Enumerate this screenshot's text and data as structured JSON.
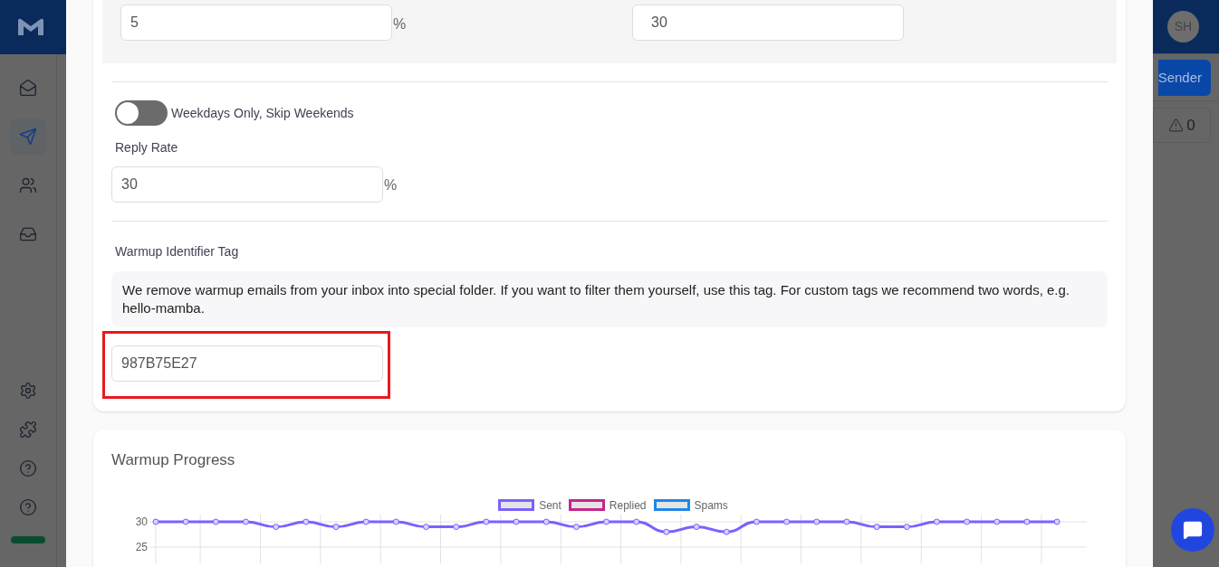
{
  "sidebar": {
    "items": [
      {
        "selected": false
      },
      {
        "selected": true
      },
      {
        "selected": false
      },
      {
        "selected": false
      }
    ],
    "bottom_items": [
      {
        "selected": false
      },
      {
        "selected": false
      },
      {
        "selected": false
      },
      {
        "selected": false
      }
    ]
  },
  "header": {
    "avatar": "SH"
  },
  "toolbar": {
    "button": "Sender",
    "warning_count": "0"
  },
  "settings": {
    "top_fields": [
      {
        "value": "5",
        "suffix": "%"
      },
      {
        "value": "30"
      }
    ],
    "weekdays_toggle": {
      "label": "Weekdays Only, Skip Weekends",
      "on": false
    },
    "reply_rate": {
      "label": "Reply Rate",
      "value": "30",
      "suffix": "%"
    },
    "identifier": {
      "label": "Warmup Identifier Tag",
      "info": "We remove warmup emails from your inbox into special folder. If you want to filter them yourself, use this tag. For custom tags we recommend two words, e.g. hello-mamba.",
      "value": "987B75E27",
      "highlighted": true
    }
  },
  "progress": {
    "title": "Warmup Progress",
    "chart_data": {
      "type": "line",
      "ylim": [
        25,
        30
      ],
      "yticks": [
        25,
        30
      ],
      "series": [
        {
          "name": "Sent",
          "color": "#7b61ff",
          "marker": true,
          "values": [
            30,
            30,
            30,
            30,
            29,
            30,
            29,
            30,
            30,
            29,
            29,
            30,
            30,
            30,
            29,
            30,
            30,
            28,
            29,
            28,
            30,
            30,
            30,
            30,
            29,
            29,
            30,
            30,
            30,
            30,
            30,
            null
          ]
        },
        {
          "name": "Replied",
          "color": "#c4268c",
          "values": [
            null,
            null,
            null,
            null,
            null,
            null,
            null,
            null,
            null,
            null,
            null,
            null,
            null,
            null,
            null,
            null,
            null,
            null,
            null,
            null,
            null,
            null,
            null,
            null,
            null,
            null,
            null,
            null,
            null,
            null,
            null,
            null
          ]
        },
        {
          "name": "Spams",
          "color": "#1e88e5",
          "values": [
            null,
            null,
            null,
            null,
            null,
            null,
            null,
            null,
            null,
            null,
            null,
            null,
            null,
            null,
            null,
            null,
            null,
            null,
            null,
            null,
            null,
            null,
            null,
            null,
            null,
            null,
            null,
            null,
            null,
            null,
            null,
            null
          ]
        }
      ]
    }
  }
}
